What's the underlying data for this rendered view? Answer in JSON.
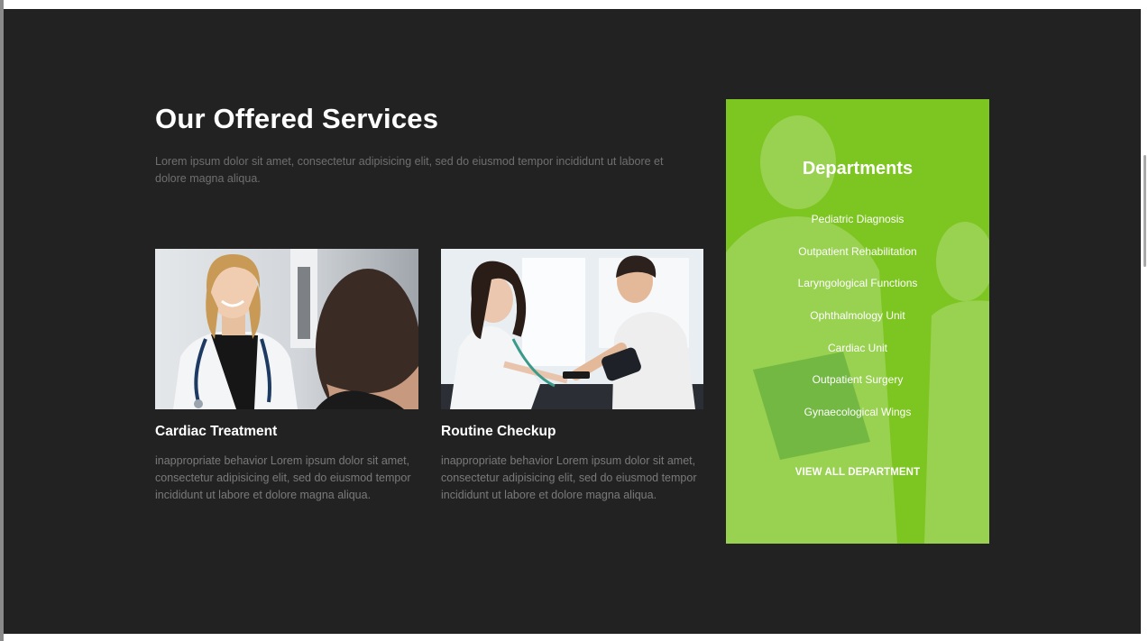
{
  "services": {
    "heading": "Our Offered Services",
    "intro": "Lorem ipsum dolor sit amet, consectetur adipisicing elit, sed do eiusmod tempor incididunt ut labore et dolore magna aliqua.",
    "cards": [
      {
        "title": "Cardiac Treatment",
        "text": "inappropriate behavior Lorem ipsum dolor sit amet, consectetur adipisicing elit, sed do eiusmod tempor incididunt ut labore et dolore magna aliqua."
      },
      {
        "title": "Routine Checkup",
        "text": "inappropriate behavior Lorem ipsum dolor sit amet, consectetur adipisicing elit, sed do eiusmod tempor incididunt ut labore et dolore magna aliqua."
      }
    ]
  },
  "departments": {
    "title": "Departments",
    "items": [
      "Pediatric Diagnosis",
      "Outpatient Rehabilitation",
      "Laryngological Functions",
      "Ophthalmology Unit",
      "Cardiac Unit",
      "Outpatient Surgery",
      "Gynaecological Wings"
    ],
    "view_all": "VIEW ALL DEPARTMENT"
  },
  "colors": {
    "section_bg": "#222222",
    "accent_green": "#7dc520",
    "heading_text": "#ffffff",
    "muted_text": "#6f6f6f"
  }
}
